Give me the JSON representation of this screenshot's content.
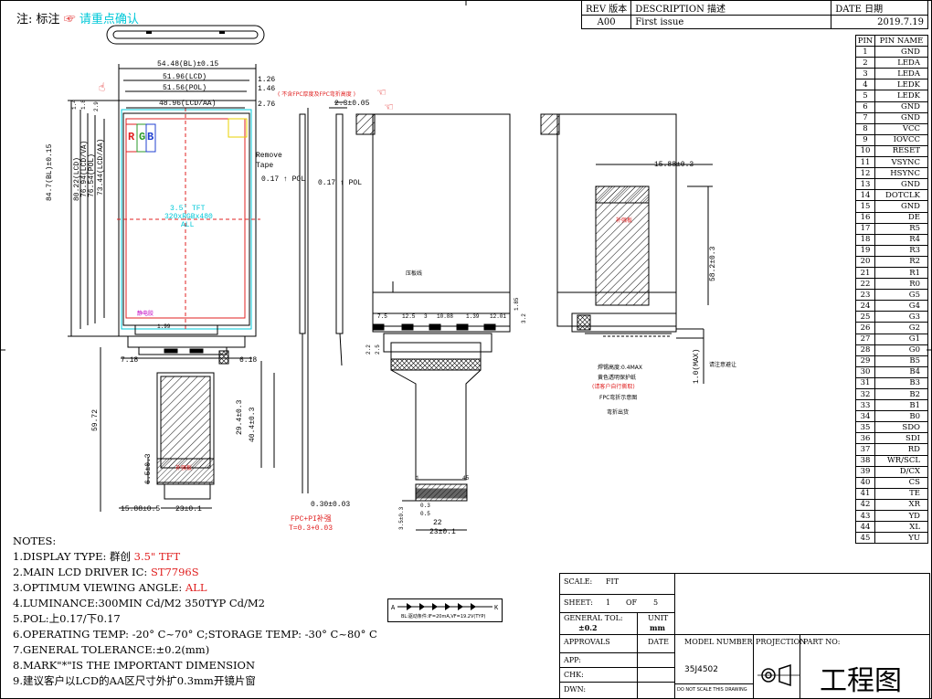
{
  "header_note": {
    "prefix": "注: 标注",
    "text": "请重点确认"
  },
  "revision": {
    "h_rev": "REV 版本",
    "h_desc": "DESCRIPTION 描述",
    "h_date": "DATE 日期",
    "rev": "A00",
    "desc": "First issue",
    "date": "2019.7.19"
  },
  "pins_header": {
    "pin": "PIN",
    "name": "PIN NAME"
  },
  "pins": [
    {
      "n": "1",
      "name": "GND"
    },
    {
      "n": "2",
      "name": "LEDA"
    },
    {
      "n": "3",
      "name": "LEDA"
    },
    {
      "n": "4",
      "name": "LEDK"
    },
    {
      "n": "5",
      "name": "LEDK"
    },
    {
      "n": "6",
      "name": "GND"
    },
    {
      "n": "7",
      "name": "GND"
    },
    {
      "n": "8",
      "name": "VCC"
    },
    {
      "n": "9",
      "name": "IOVCC"
    },
    {
      "n": "10",
      "name": "RESET"
    },
    {
      "n": "11",
      "name": "VSYNC"
    },
    {
      "n": "12",
      "name": "HSYNC"
    },
    {
      "n": "13",
      "name": "GND"
    },
    {
      "n": "14",
      "name": "DOTCLK"
    },
    {
      "n": "15",
      "name": "GND"
    },
    {
      "n": "16",
      "name": "DE"
    },
    {
      "n": "17",
      "name": "R5"
    },
    {
      "n": "18",
      "name": "R4"
    },
    {
      "n": "19",
      "name": "R3"
    },
    {
      "n": "20",
      "name": "R2"
    },
    {
      "n": "21",
      "name": "R1"
    },
    {
      "n": "22",
      "name": "R0"
    },
    {
      "n": "23",
      "name": "G5"
    },
    {
      "n": "24",
      "name": "G4"
    },
    {
      "n": "25",
      "name": "G3"
    },
    {
      "n": "26",
      "name": "G2"
    },
    {
      "n": "27",
      "name": "G1"
    },
    {
      "n": "28",
      "name": "G0"
    },
    {
      "n": "29",
      "name": "B5"
    },
    {
      "n": "30",
      "name": "B4"
    },
    {
      "n": "31",
      "name": "B3"
    },
    {
      "n": "32",
      "name": "B2"
    },
    {
      "n": "33",
      "name": "B1"
    },
    {
      "n": "34",
      "name": "B0"
    },
    {
      "n": "35",
      "name": "SDO"
    },
    {
      "n": "36",
      "name": "SDI"
    },
    {
      "n": "37",
      "name": "RD"
    },
    {
      "n": "38",
      "name": "WR/SCL"
    },
    {
      "n": "39",
      "name": "D/CX"
    },
    {
      "n": "40",
      "name": "CS"
    },
    {
      "n": "41",
      "name": "TE"
    },
    {
      "n": "42",
      "name": "XR"
    },
    {
      "n": "43",
      "name": "YD"
    },
    {
      "n": "44",
      "name": "XL"
    },
    {
      "n": "45",
      "name": "YU"
    }
  ],
  "notes": {
    "title": "NOTES:",
    "lines": [
      {
        "a": "1.DISPLAY TYPE:  群创 ",
        "b": "3.5\" ",
        "c": "TFT"
      },
      {
        "a": "2.MAIN LCD DRIVER IC: ",
        "b": "ST7796S",
        "c": ""
      },
      {
        "a": "3.OPTIMUM VIEWING ANGLE: ",
        "b": "ALL",
        "c": ""
      },
      {
        "a": "4.LUMINANCE:300MIN Cd/M2 350TYP Cd/M2",
        "b": "",
        "c": ""
      },
      {
        "a": "5.POL:上0.17/下0.17",
        "b": "",
        "c": ""
      },
      {
        "a": "6.OPERATING TEMP: -20° C~70° C;STORAGE TEMP: -30° C~80° C",
        "b": "",
        "c": ""
      },
      {
        "a": "7.GENERAL TOLERANCE:±0.2(mm)",
        "b": "",
        "c": ""
      },
      {
        "a": "8.MARK\"*\"IS THE IMPORTANT DIMENSION",
        "b": "",
        "c": ""
      },
      {
        "a": "9.建议客户以LCD的AA区尺寸外扩0.3mm开镜片窗",
        "b": "",
        "c": ""
      }
    ]
  },
  "bl_circuit": {
    "a": "A",
    "k": "K",
    "caption": "BL:驱动条件:IF=20mA,VF=19.2V(TYP)"
  },
  "title_block": {
    "scale_label": "SCALE:",
    "scale": "FIT",
    "sheet_label": "SHEET:",
    "sheet": "1",
    "of": "OF",
    "sheets": "5",
    "tol_label": "GENERAL TOL:",
    "tol": "±0.2",
    "unit_label": "UNIT",
    "unit": "mm",
    "approvals": "APPROVALS",
    "date": "DATE",
    "app": "APP:",
    "chk": "CHK:",
    "dwn": "DWN:",
    "model_label": "MODEL NUMBER",
    "model": "35J4502",
    "projection": "PROJECTION",
    "part_no": "PART NO:",
    "no_scale": "DO NOT SCALE THIS DRAWING",
    "drawing_title": "工程图"
  },
  "front": {
    "dims_top": [
      "54.48(BL)±0.15",
      "51.96(LCD)",
      "51.56(POL)",
      "48.96(LCD/AA)"
    ],
    "dims_top_right": [
      "1.26",
      "1.46",
      "2.76"
    ],
    "dims_left": [
      "84.7(BL)±0.15",
      "80.22(LCD)",
      "76.94(LCD/VA)",
      "76.54(POL)",
      "73.44(LCD/AA)"
    ],
    "dims_left_small": [
      "1.4",
      "1.8",
      "2.9"
    ],
    "rgb": [
      "R",
      "G",
      "B"
    ],
    "center": [
      "3.5' TFT",
      "320xRGBx480",
      "ALL"
    ],
    "remove_tape": [
      "Remove",
      "Tape"
    ],
    "small_mark": "静电胶",
    "dim_199": "1.99",
    "dims_fpc": [
      "7.18",
      "6.18",
      "59.72",
      "29.4±0.3",
      "40.4±0.3",
      "6.5±0.3",
      "15.88±0.5",
      "23±0.1"
    ],
    "fpc_label": "补强板"
  },
  "side": {
    "note": "( 不含FPC厚度及FPC弯折高度 )",
    "dims": [
      "2.3±0.05",
      "0.17 ↑ POL",
      "0.17 ↑ POL",
      "0.30±0.03"
    ],
    "fpc_pi": "FPC+PI补强",
    "fpc_t": "T=0.3+0.03"
  },
  "back": {
    "label": "压板线",
    "dims": [
      "7.5",
      "12.5",
      "3",
      "10.88",
      "1.39",
      "12.01",
      "1.85",
      "3.2",
      "2.2",
      "2.5"
    ],
    "pin1": "1",
    "pin45": "45",
    "bottom_dims": [
      "0.3",
      "0.5",
      "3.5±0.3",
      "22",
      "23±0.1"
    ]
  },
  "bent": {
    "dims": [
      "15.88±0.3",
      "58.2±0.3",
      "1.0(MAX)"
    ],
    "note_side": "请注意避让",
    "notes": [
      "焊锡高度:0.4MAX",
      "黄色透明保护纸",
      "(请客户自行撕取)",
      "FPC弯折示意图",
      "弯折出货"
    ],
    "label": "补强板"
  }
}
